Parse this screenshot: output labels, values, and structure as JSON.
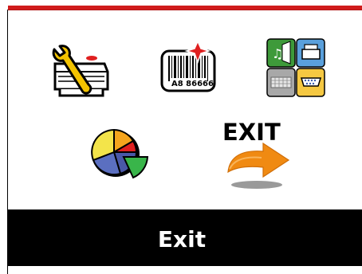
{
  "menu": {
    "items": [
      {
        "id": "settings",
        "icon": "wrench-printer-icon"
      },
      {
        "id": "barcode",
        "icon": "barcode-label-icon",
        "barcode_text": "A8 86666"
      },
      {
        "id": "interfaces",
        "icon": "interface-ports-icon"
      },
      {
        "id": "statistics",
        "icon": "pie-chart-icon"
      },
      {
        "id": "exit",
        "icon": "exit-arrow-icon",
        "icon_text": "EXIT"
      }
    ],
    "selected": "exit"
  },
  "status": {
    "label": "Exit"
  },
  "colors": {
    "top_bar": "#d01b1b",
    "bottom_bar": "#000000",
    "label_text": "#ffffff",
    "arrow": "#f08a12"
  }
}
